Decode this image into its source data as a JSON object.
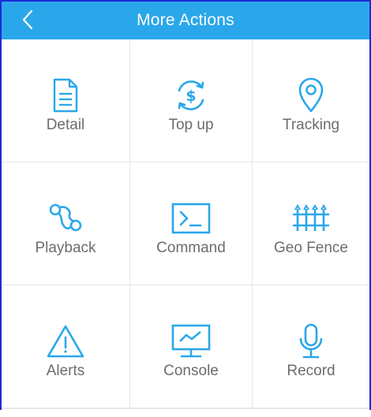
{
  "header": {
    "title": "More Actions",
    "back_icon": "chevron-left-icon"
  },
  "colors": {
    "header_bg": "#2aa7ea",
    "icon": "#2aa7ea",
    "label": "#6c6c6c",
    "divider": "#e6e6e6",
    "frame": "#1c2bd6"
  },
  "actions": [
    {
      "label": "Detail",
      "icon": "document-icon"
    },
    {
      "label": "Top up",
      "icon": "dollar-refresh-icon"
    },
    {
      "label": "Tracking",
      "icon": "location-pin-icon"
    },
    {
      "label": "Playback",
      "icon": "route-icon"
    },
    {
      "label": "Command",
      "icon": "terminal-icon"
    },
    {
      "label": "Geo Fence",
      "icon": "fence-icon"
    },
    {
      "label": "Alerts",
      "icon": "warning-icon"
    },
    {
      "label": "Console",
      "icon": "monitor-chart-icon"
    },
    {
      "label": "Record",
      "icon": "microphone-icon"
    }
  ]
}
